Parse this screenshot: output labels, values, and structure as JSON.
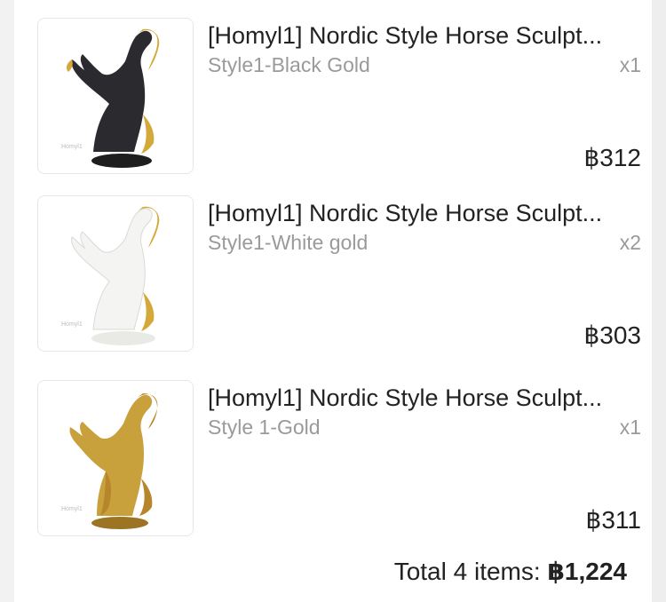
{
  "order": {
    "items": [
      {
        "title": "[Homyl1] Nordic Style Horse Sculpt...",
        "variant": "Style1-Black Gold",
        "quantity": "x1",
        "price": "฿312",
        "image_icon": "black-gold-horse-sculpture-image",
        "body_color": "#2b2b2f",
        "accent_color": "#d4a93a",
        "base_color": "#1e1e1e",
        "watermark": "Homyl1"
      },
      {
        "title": "[Homyl1] Nordic Style Horse Sculpt...",
        "variant": "Style1-White gold",
        "quantity": "x2",
        "price": "฿303",
        "image_icon": "white-gold-horse-sculpture-image",
        "body_color": "#f4f4f2",
        "accent_color": "#d4a93a",
        "base_color": "#e9e9e6",
        "watermark": "Homyl1"
      },
      {
        "title": "[Homyl1] Nordic Style Horse Sculpt...",
        "variant": "Style 1-Gold",
        "quantity": "x1",
        "price": "฿311",
        "image_icon": "gold-horse-sculpture-image",
        "body_color": "#c9a13c",
        "accent_color": "#b8862a",
        "base_color": "#9c7424",
        "watermark": "Homyl1"
      }
    ],
    "total_label": "Total 4 items: ",
    "total_amount": "฿1,224"
  }
}
